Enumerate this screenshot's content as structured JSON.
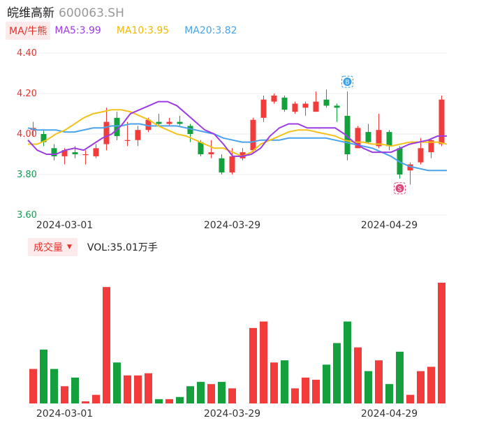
{
  "header": {
    "name": "皖维高新",
    "code": "600063.SH"
  },
  "ma": {
    "badge": "MA/牛熊",
    "ma5": "MA5:3.99",
    "ma10": "MA10:3.95",
    "ma20": "MA20:3.82"
  },
  "volume": {
    "badge": "成交量",
    "text": "VOL:35.01万手"
  },
  "markers": {
    "buy": "B",
    "sell": "S"
  },
  "colors": {
    "up": "#f23c3c",
    "down": "#14a03c",
    "ma5": "#9b3ce3",
    "ma10": "#f2c21b",
    "ma20": "#4aa3ea"
  },
  "chart_data": {
    "type": "candlestick",
    "ylim": [
      3.6,
      4.4
    ],
    "yticks": [
      "3.60",
      "3.80",
      "4.00",
      "4.20",
      "4.40"
    ],
    "date_labels": [
      {
        "index": 3,
        "label": "2024-03-01"
      },
      {
        "index": 19,
        "label": "2024-03-29"
      },
      {
        "index": 34,
        "label": "2024-04-29"
      }
    ],
    "candles": [
      {
        "o": 4.02,
        "c": 4.03,
        "h": 4.06,
        "l": 3.99,
        "v": 16
      },
      {
        "o": 4.0,
        "c": 3.96,
        "h": 4.02,
        "l": 3.94,
        "v": 25
      },
      {
        "o": 3.93,
        "c": 3.89,
        "h": 3.95,
        "l": 3.87,
        "v": 16
      },
      {
        "o": 3.89,
        "c": 3.92,
        "h": 3.93,
        "l": 3.85,
        "v": 8
      },
      {
        "o": 3.91,
        "c": 3.9,
        "h": 3.94,
        "l": 3.88,
        "v": 12
      },
      {
        "o": 3.9,
        "c": 3.9,
        "h": 3.92,
        "l": 3.85,
        "v": 1
      },
      {
        "o": 3.89,
        "c": 3.93,
        "h": 3.95,
        "l": 3.88,
        "v": 4
      },
      {
        "o": 3.95,
        "c": 4.06,
        "h": 4.13,
        "l": 3.92,
        "v": 54
      },
      {
        "o": 4.08,
        "c": 3.99,
        "h": 4.11,
        "l": 3.97,
        "v": 19
      },
      {
        "o": 3.97,
        "c": 3.97,
        "h": 4.06,
        "l": 3.94,
        "v": 13
      },
      {
        "o": 3.97,
        "c": 4.02,
        "h": 4.04,
        "l": 3.94,
        "v": 13
      },
      {
        "o": 4.02,
        "c": 4.07,
        "h": 4.08,
        "l": 4.01,
        "v": 14
      },
      {
        "o": 4.06,
        "c": 4.05,
        "h": 4.1,
        "l": 4.04,
        "v": 2
      },
      {
        "o": 4.05,
        "c": 4.06,
        "h": 4.08,
        "l": 4.04,
        "v": 2
      },
      {
        "o": 4.06,
        "c": 4.05,
        "h": 4.09,
        "l": 4.04,
        "v": 3
      },
      {
        "o": 4.04,
        "c": 4.0,
        "h": 4.05,
        "l": 3.96,
        "v": 8
      },
      {
        "o": 3.96,
        "c": 3.9,
        "h": 3.97,
        "l": 3.89,
        "v": 10
      },
      {
        "o": 3.9,
        "c": 3.91,
        "h": 3.97,
        "l": 3.88,
        "v": 9
      },
      {
        "o": 3.88,
        "c": 3.81,
        "h": 3.9,
        "l": 3.8,
        "v": 10
      },
      {
        "o": 3.81,
        "c": 3.89,
        "h": 3.93,
        "l": 3.8,
        "v": 7
      },
      {
        "o": 3.88,
        "c": 3.91,
        "h": 3.93,
        "l": 3.87,
        "v": 0
      },
      {
        "o": 3.92,
        "c": 4.07,
        "h": 4.08,
        "l": 3.91,
        "v": 35
      },
      {
        "o": 4.08,
        "c": 4.17,
        "h": 4.19,
        "l": 4.06,
        "v": 38
      },
      {
        "o": 4.16,
        "c": 4.19,
        "h": 4.2,
        "l": 4.15,
        "v": 19
      },
      {
        "o": 4.18,
        "c": 4.12,
        "h": 4.19,
        "l": 4.11,
        "v": 20
      },
      {
        "o": 4.11,
        "c": 4.15,
        "h": 4.16,
        "l": 4.1,
        "v": 7
      },
      {
        "o": 4.13,
        "c": 4.15,
        "h": 4.16,
        "l": 4.09,
        "v": 12
      },
      {
        "o": 4.11,
        "c": 4.16,
        "h": 4.21,
        "l": 4.11,
        "v": 11
      },
      {
        "o": 4.17,
        "c": 4.14,
        "h": 4.22,
        "l": 4.13,
        "v": 18
      },
      {
        "o": 4.14,
        "c": 4.13,
        "h": 4.15,
        "l": 4.06,
        "v": 28
      },
      {
        "o": 4.09,
        "c": 3.9,
        "h": 4.21,
        "l": 3.87,
        "v": 38
      },
      {
        "o": 3.93,
        "c": 4.03,
        "h": 4.04,
        "l": 3.93,
        "v": 26
      },
      {
        "o": 4.01,
        "c": 3.96,
        "h": 4.05,
        "l": 3.95,
        "v": 15
      },
      {
        "o": 3.94,
        "c": 4.02,
        "h": 4.1,
        "l": 3.93,
        "v": 20
      },
      {
        "o": 4.01,
        "c": 3.94,
        "h": 4.02,
        "l": 3.92,
        "v": 9
      },
      {
        "o": 3.93,
        "c": 3.8,
        "h": 3.94,
        "l": 3.78,
        "v": 24
      },
      {
        "o": 3.82,
        "c": 3.85,
        "h": 3.86,
        "l": 3.75,
        "v": 4
      },
      {
        "o": 3.86,
        "c": 3.93,
        "h": 3.98,
        "l": 3.85,
        "v": 15
      },
      {
        "o": 3.91,
        "c": 3.97,
        "h": 3.98,
        "l": 3.88,
        "v": 17
      },
      {
        "o": 3.95,
        "c": 4.17,
        "h": 4.19,
        "l": 3.94,
        "v": 56
      }
    ],
    "ma5": [
      3.97,
      3.92,
      3.9,
      3.9,
      3.92,
      3.93,
      3.92,
      3.95,
      3.98,
      4.0,
      4.04,
      4.1,
      4.12,
      4.14,
      4.16,
      4.16,
      4.14,
      4.1,
      4.06,
      4.02,
      4.0,
      3.95,
      3.89,
      3.89,
      3.9,
      3.93,
      3.99,
      4.03,
      4.05,
      4.05,
      4.03,
      4.03,
      4.03,
      4.03,
      4.0,
      3.96,
      3.93,
      3.91,
      3.91,
      3.91,
      3.93,
      3.95,
      3.96,
      3.97,
      3.99,
      3.99
    ],
    "ma10": [
      3.95,
      3.95,
      3.97,
      4.0,
      4.02,
      4.05,
      4.08,
      4.1,
      4.11,
      4.12,
      4.12,
      4.11,
      4.09,
      4.07,
      4.04,
      4.02,
      4.0,
      3.99,
      3.97,
      3.95,
      3.93,
      3.93,
      3.91,
      3.89,
      3.91,
      3.95,
      3.97,
      3.99,
      4.01,
      4.02,
      4.02,
      4.01,
      4.0,
      3.99,
      3.97,
      3.96,
      3.96,
      3.95,
      3.95,
      3.94,
      3.95,
      3.96,
      3.96,
      3.96,
      3.96,
      3.95
    ],
    "ma20": [
      4.03,
      4.02,
      4.02,
      4.02,
      4.01,
      4.01,
      4.02,
      4.03,
      4.03,
      4.04,
      4.04,
      4.05,
      4.05,
      4.04,
      4.04,
      4.04,
      4.04,
      4.03,
      4.02,
      4.01,
      4.0,
      3.98,
      3.97,
      3.96,
      3.96,
      3.97,
      3.97,
      3.97,
      3.98,
      3.98,
      3.98,
      3.98,
      3.98,
      3.97,
      3.96,
      3.95,
      3.94,
      3.93,
      3.91,
      3.89,
      3.86,
      3.84,
      3.83,
      3.82,
      3.82,
      3.82
    ],
    "buy_index": 30,
    "sell_index": 35
  }
}
